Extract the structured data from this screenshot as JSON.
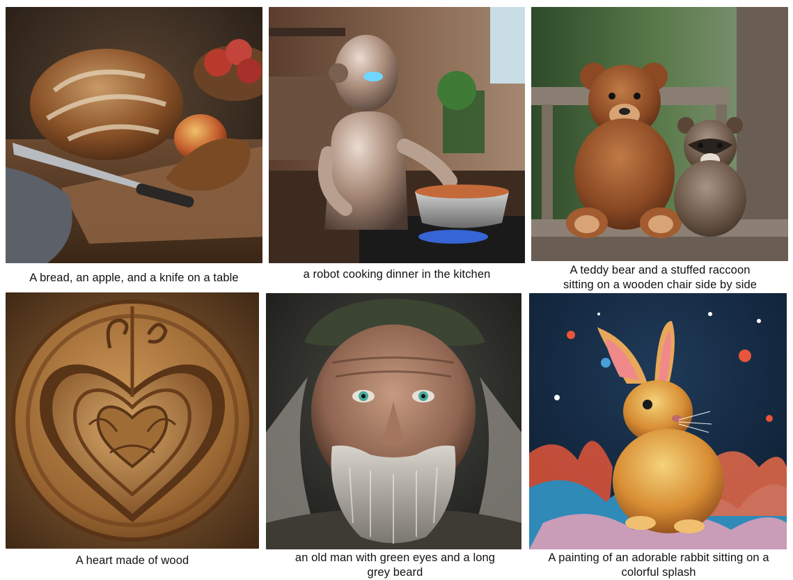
{
  "figure": {
    "panels": [
      {
        "caption": "A bread, an apple, and a knife on a table"
      },
      {
        "caption": "a robot cooking dinner in the kitchen"
      },
      {
        "caption": "A teddy bear and a stuffed raccoon sitting on a wooden chair side by side"
      },
      {
        "caption": "A heart made of wood"
      },
      {
        "caption": "an old man with green eyes and a long grey beard"
      },
      {
        "caption": "A painting of an adorable rabbit sitting on a colorful splash"
      }
    ]
  }
}
